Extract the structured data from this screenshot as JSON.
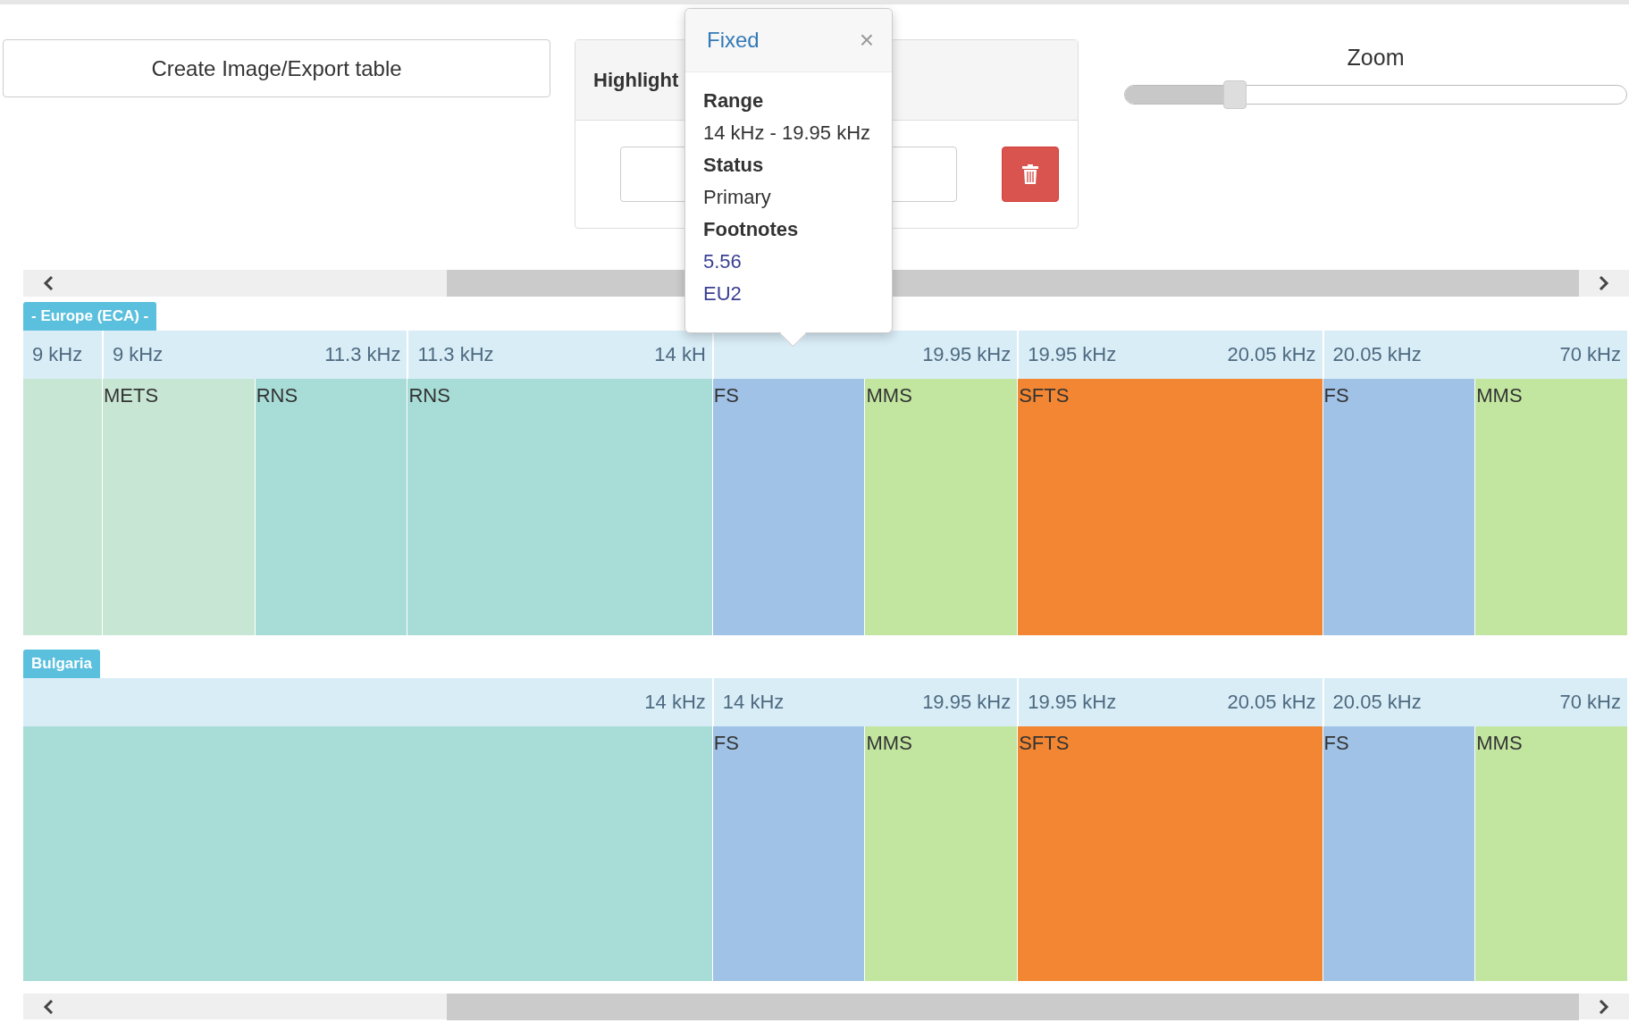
{
  "export_button": {
    "label": "Create Image/Export table"
  },
  "highlight_panel": {
    "title": "Highlight"
  },
  "zoom": {
    "label": "Zoom",
    "level": 0.22
  },
  "popover": {
    "title": "Fixed",
    "close": "×",
    "fields": [
      {
        "label": "Range",
        "kind": "text",
        "value": "14 kHz - 19.95 kHz"
      },
      {
        "label": "Status",
        "kind": "text",
        "value": "Primary"
      },
      {
        "label": "Footnotes",
        "kind": "links",
        "links": [
          "5.56",
          "EU2"
        ]
      }
    ]
  },
  "sections": [
    {
      "name": "- Europe (ECA) -",
      "ranges": [
        {
          "start": "9 kHz"
        },
        {
          "start": "9 kHz",
          "end": "11.3 kHz"
        },
        {
          "start": "11.3 kHz",
          "end": "14 kH"
        },
        {
          "end": "19.95 kHz"
        },
        {
          "start": "19.95 kHz",
          "end": "20.05 kHz"
        },
        {
          "start": "20.05 kHz",
          "end": "70 kHz"
        }
      ],
      "bands": [
        {
          "color": "#c8e6d4"
        },
        {
          "label": "METS",
          "color": "#c8e6d4"
        },
        {
          "label": "RNS",
          "color": "#a8dcd6"
        },
        {
          "label": "RNS",
          "color": "#a8dcd6"
        },
        {
          "label": "FS",
          "color": "#a0c2e6"
        },
        {
          "label": "MMS",
          "color": "#c2e6a0"
        },
        {
          "label": "SFTS",
          "color": "#f28632"
        },
        {
          "label": "FS",
          "color": "#a0c2e6"
        },
        {
          "label": "MMS",
          "color": "#c2e6a0"
        }
      ]
    },
    {
      "name": "Bulgaria",
      "ranges": [
        {
          "end": "14 kHz"
        },
        {
          "start": "14 kHz",
          "end": "19.95 kHz"
        },
        {
          "start": "19.95 kHz",
          "end": "20.05 kHz"
        },
        {
          "start": "20.05 kHz",
          "end": "70 kHz"
        }
      ],
      "bands": [
        {
          "color": "#a8dcd6"
        },
        {
          "label": "FS",
          "color": "#a0c2e6"
        },
        {
          "label": "MMS",
          "color": "#c2e6a0"
        },
        {
          "label": "SFTS",
          "color": "#f28632"
        },
        {
          "label": "FS",
          "color": "#a0c2e6"
        },
        {
          "label": "MMS",
          "color": "#c2e6a0"
        }
      ]
    }
  ]
}
